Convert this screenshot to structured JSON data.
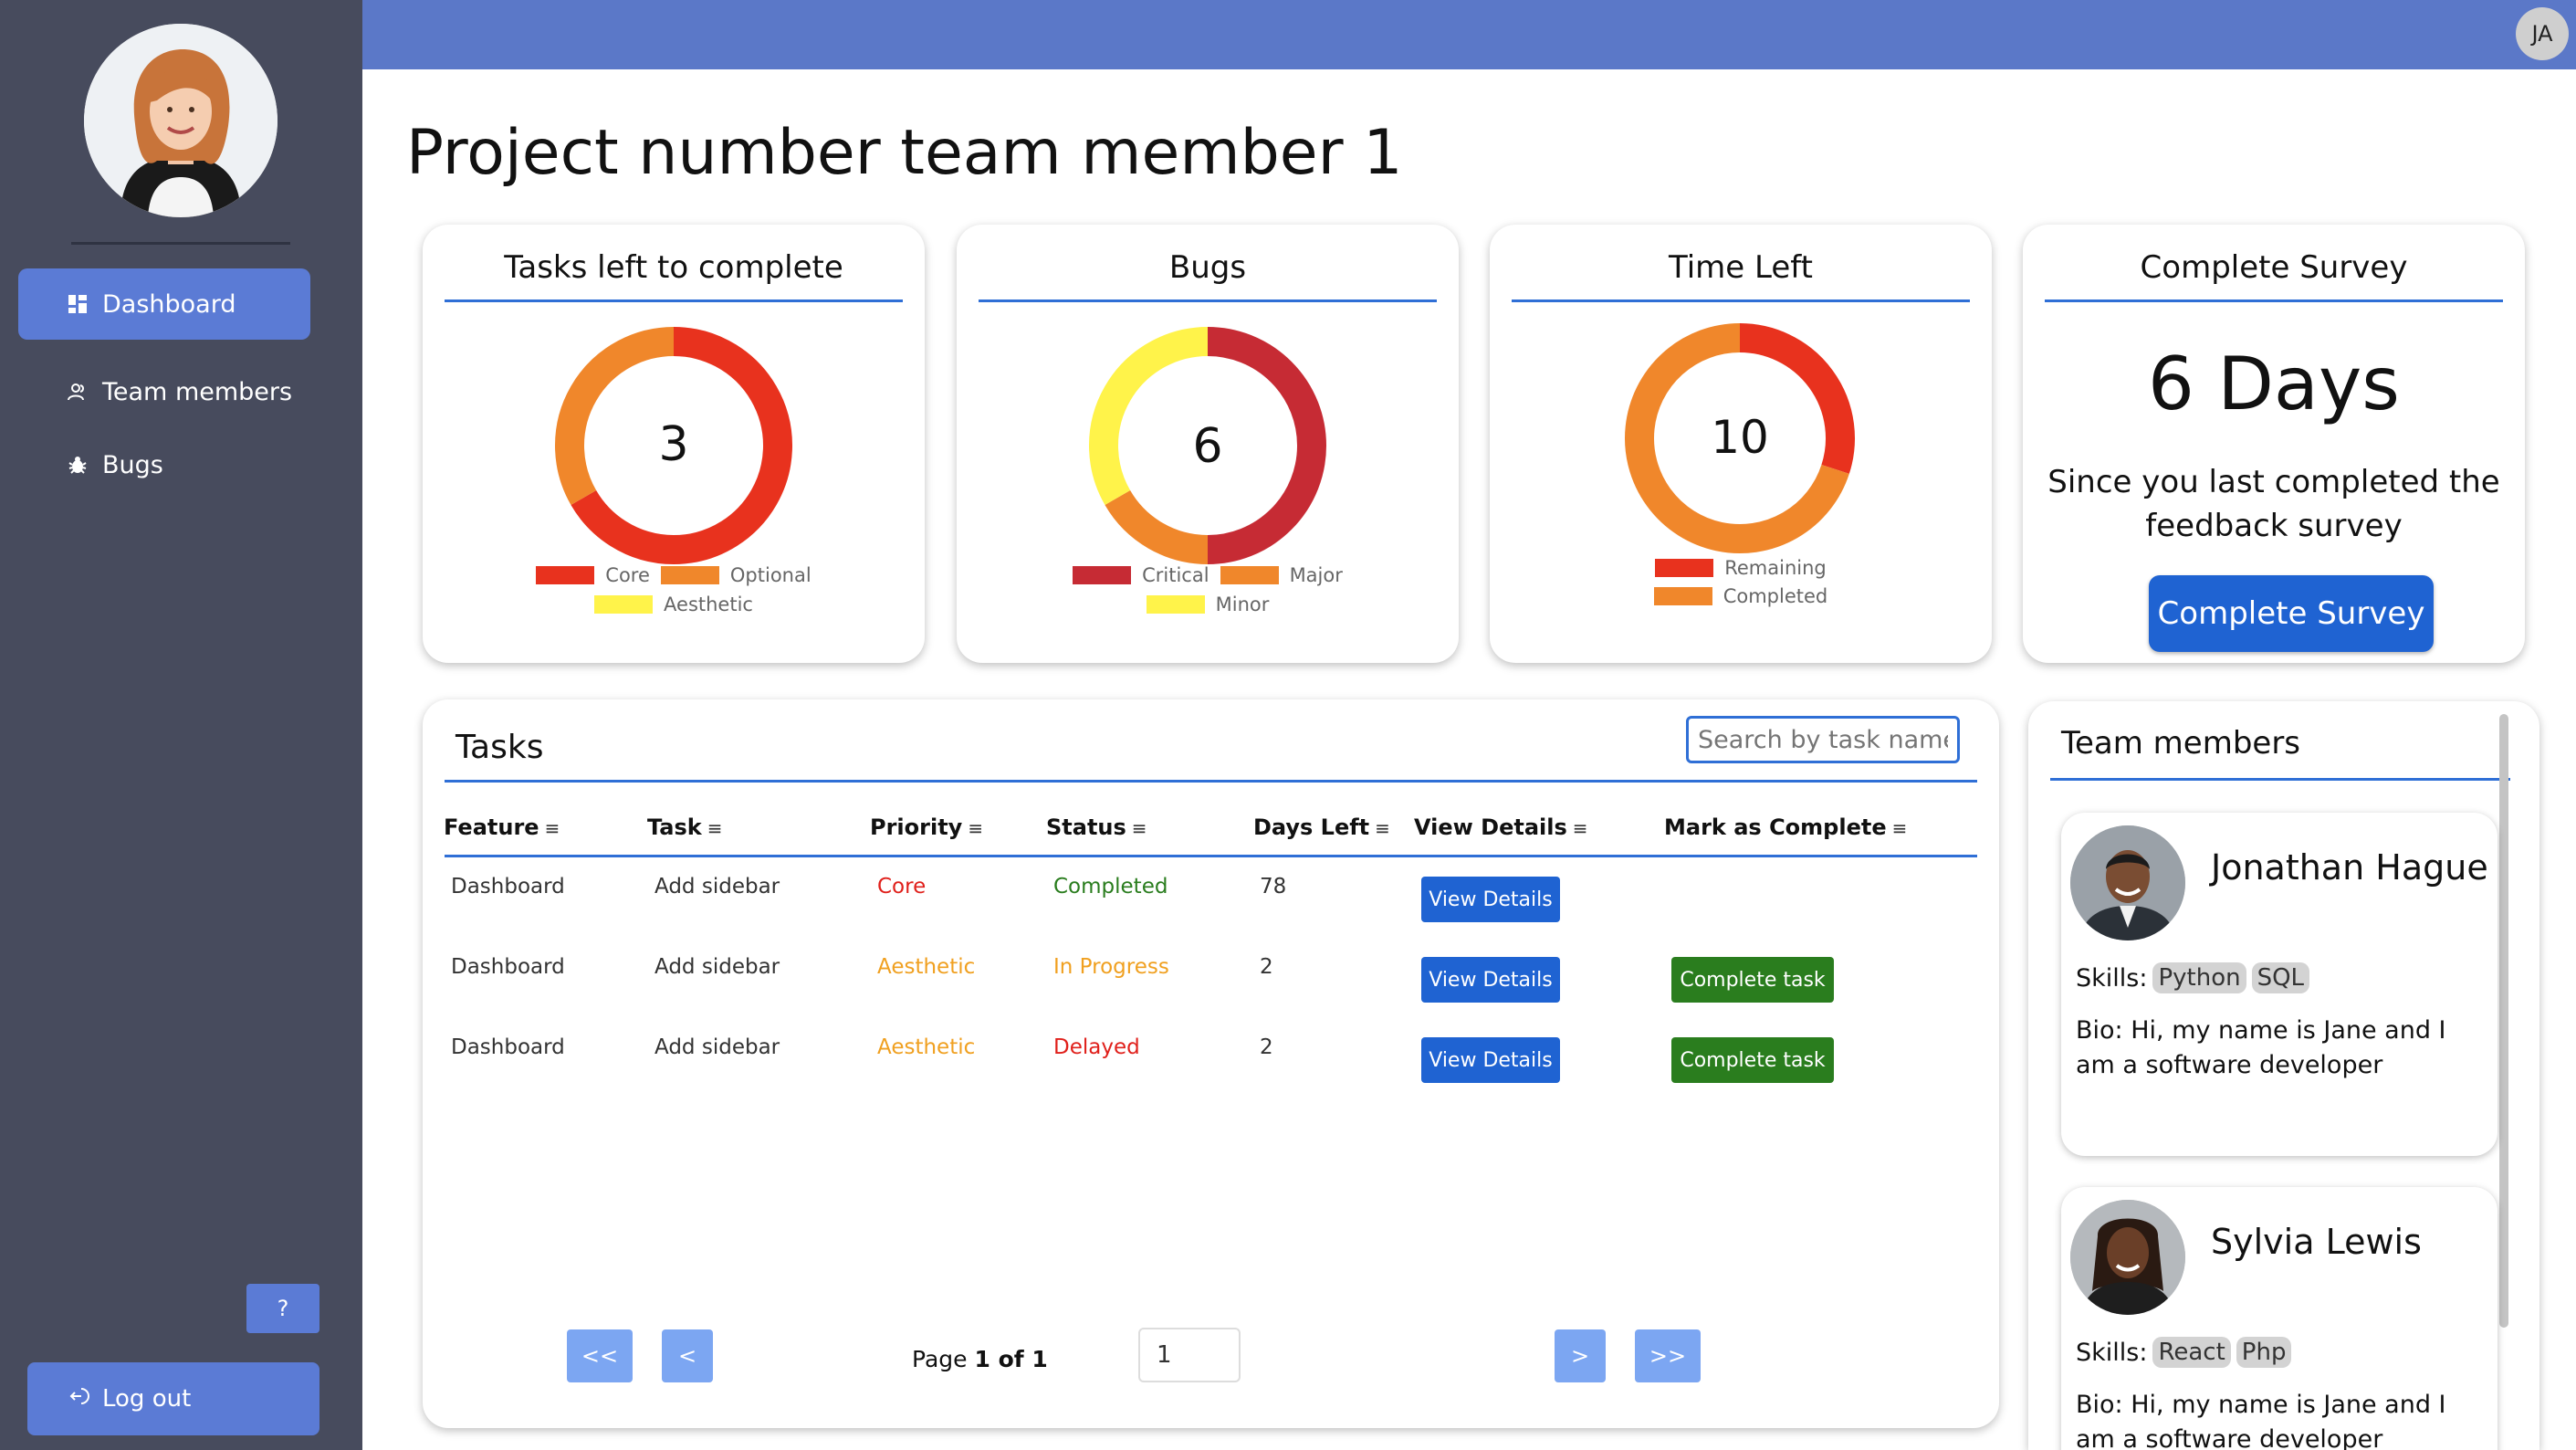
{
  "user": {
    "initials": "JA"
  },
  "sidebar": {
    "items": [
      {
        "label": "Dashboard",
        "icon": "dashboard-icon",
        "active": true
      },
      {
        "label": "Team members",
        "icon": "team-icon",
        "active": false
      },
      {
        "label": "Bugs",
        "icon": "bug-icon",
        "active": false
      }
    ],
    "help_label": "?",
    "logout_label": "Log out"
  },
  "page": {
    "title": "Project number team member 1"
  },
  "cards": {
    "tasks_left": {
      "title": "Tasks left to complete",
      "center": "3",
      "legend": [
        {
          "label": "Core",
          "color": "#e8321e"
        },
        {
          "label": "Optional",
          "color": "#f0872b"
        },
        {
          "label": "Aesthetic",
          "color": "#fff34a"
        }
      ]
    },
    "bugs": {
      "title": "Bugs",
      "center": "6",
      "legend": [
        {
          "label": "Critical",
          "color": "#c62b34"
        },
        {
          "label": "Major",
          "color": "#f0872b"
        },
        {
          "label": "Minor",
          "color": "#fff34a"
        }
      ]
    },
    "time_left": {
      "title": "Time Left",
      "center": "10",
      "legend": [
        {
          "label": "Remaining",
          "color": "#e8321e"
        },
        {
          "label": "Completed",
          "color": "#f0872b"
        }
      ]
    },
    "survey": {
      "title": "Complete Survey",
      "days": "6 Days",
      "text": "Since you last completed the feedback survey",
      "button": "Complete Survey"
    }
  },
  "chart_data": [
    {
      "type": "pie",
      "title": "Tasks left to complete",
      "categories": [
        "Core",
        "Optional",
        "Aesthetic"
      ],
      "values": [
        2,
        1,
        0
      ],
      "center_label": "3"
    },
    {
      "type": "pie",
      "title": "Bugs",
      "categories": [
        "Critical",
        "Major",
        "Minor"
      ],
      "values": [
        3,
        1,
        2
      ],
      "center_label": "6"
    },
    {
      "type": "pie",
      "title": "Time Left",
      "categories": [
        "Remaining",
        "Completed"
      ],
      "values": [
        3,
        7
      ],
      "center_label": "10"
    }
  ],
  "tasks": {
    "title": "Tasks",
    "search_placeholder": "Search by task name",
    "columns": [
      "Feature",
      "Task",
      "Priority",
      "Status",
      "Days Left",
      "View Details",
      "Mark as Complete"
    ],
    "rows": [
      {
        "feature": "Dashboard",
        "task": "Add sidebar",
        "priority": "Core",
        "priority_color": "#e0201b",
        "status": "Completed",
        "status_color": "#2a7d1e",
        "days": "78",
        "view": "View Details",
        "complete": ""
      },
      {
        "feature": "Dashboard",
        "task": "Add sidebar",
        "priority": "Aesthetic",
        "priority_color": "#f0a020",
        "status": "In Progress",
        "status_color": "#f0a020",
        "days": "2",
        "view": "View Details",
        "complete": "Complete task"
      },
      {
        "feature": "Dashboard",
        "task": "Add sidebar",
        "priority": "Aesthetic",
        "priority_color": "#f0a020",
        "status": "Delayed",
        "status_color": "#e0201b",
        "days": "2",
        "view": "View Details",
        "complete": "Complete task"
      }
    ],
    "pagination": {
      "first": "<<",
      "prev": "<",
      "next": ">",
      "last": ">>",
      "page_prefix": "Page ",
      "page_of": "1 of 1",
      "page_input": "1"
    }
  },
  "team": {
    "title": "Team members",
    "skills_label": "Skills:",
    "members": [
      {
        "name": "Jonathan Hague",
        "skills": [
          "Python",
          "SQL"
        ],
        "bio": "Bio: Hi, my name is Jane and I am a software developer"
      },
      {
        "name": "Sylvia Lewis",
        "skills": [
          "React",
          "Php"
        ],
        "bio": "Bio: Hi, my name is Jane and I am a software developer"
      }
    ]
  }
}
